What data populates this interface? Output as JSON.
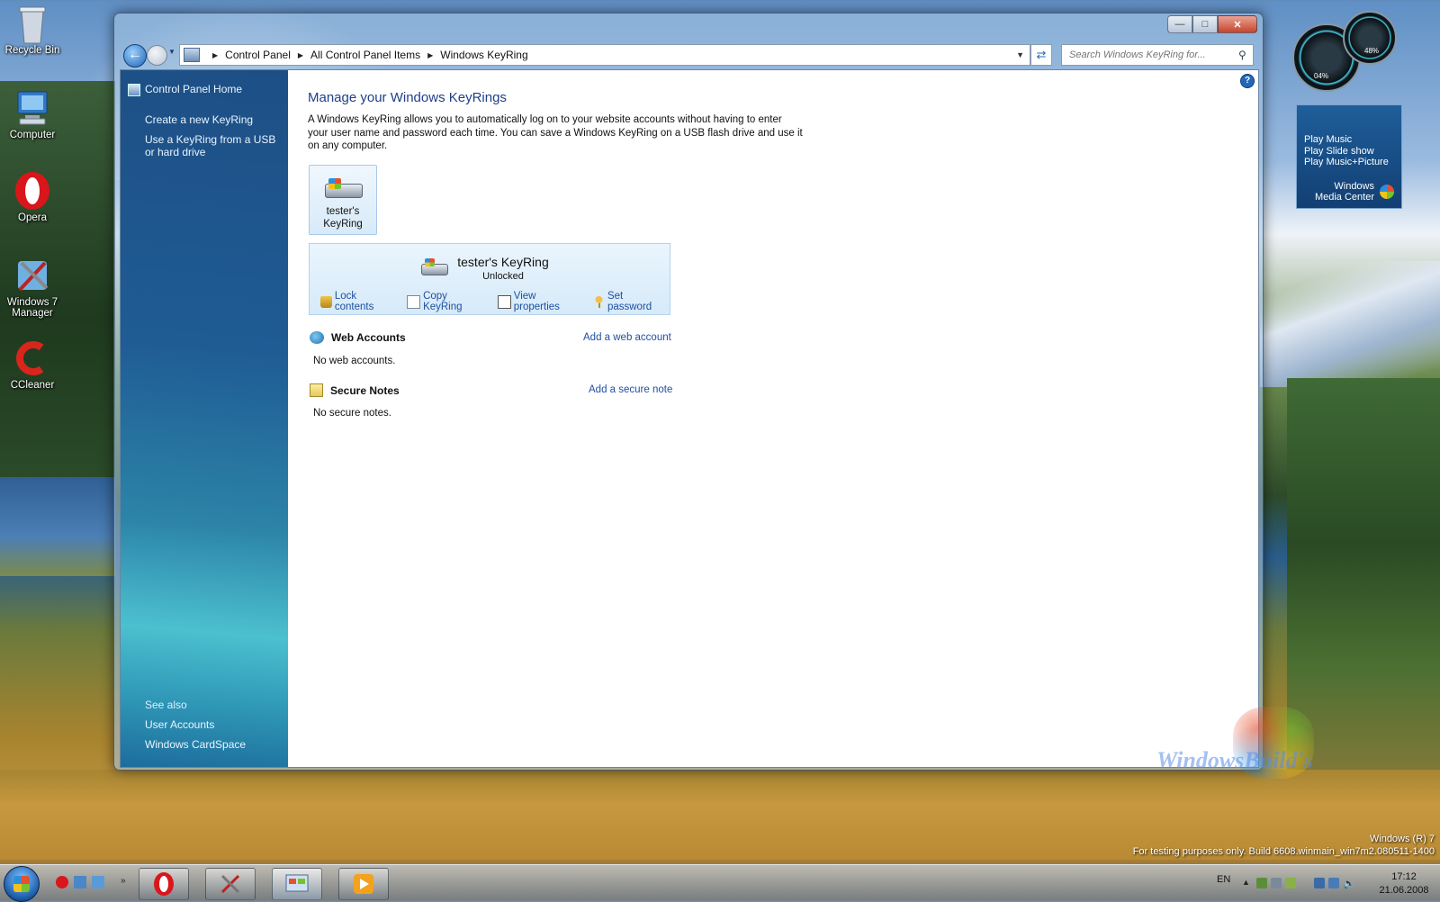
{
  "desktop": {
    "icons": [
      {
        "label": "Recycle Bin",
        "icon": "recycle-bin-icon"
      },
      {
        "label": "Computer",
        "icon": "computer-icon"
      },
      {
        "label": "Opera",
        "icon": "opera-icon"
      },
      {
        "label": "Windows 7 Manager",
        "icon": "windows7-manager-icon"
      },
      {
        "label": "CCleaner",
        "icon": "ccleaner-icon"
      }
    ],
    "build_line1": "Windows (R) 7",
    "build_line2": "For testing purposes only. Build 6608.winmain_win7m2.080511-1400"
  },
  "window": {
    "breadcrumb": [
      "Control Panel",
      "All Control Panel Items",
      "Windows KeyRing"
    ],
    "search_placeholder": "Search Windows KeyRing for...",
    "left_pane": {
      "home": "Control Panel Home",
      "links": [
        "Create a new KeyRing",
        "Use a KeyRing from a USB or hard drive"
      ],
      "see_also_title": "See also",
      "see_also": [
        "User Accounts",
        "Windows CardSpace"
      ]
    },
    "main": {
      "title": "Manage your Windows KeyRings",
      "description": "A Windows KeyRing allows you to automatically log on to your website accounts without having to enter your user name and password each time. You can save a Windows KeyRing on a USB flash drive and use it on any computer.",
      "tile_label": "tester's KeyRing",
      "panel_name": "tester's KeyRing",
      "panel_status": "Unlocked",
      "actions": [
        "Lock contents",
        "Copy KeyRing",
        "View properties",
        "Set password"
      ],
      "web_accounts": {
        "title": "Web Accounts",
        "add": "Add a web account",
        "empty": "No web accounts."
      },
      "secure_notes": {
        "title": "Secure Notes",
        "add": "Add a secure note",
        "empty": "No secure notes."
      }
    }
  },
  "gadgets": {
    "meter_value": "04%",
    "meter_value2": "48%",
    "media_center": {
      "items": [
        "Play Music",
        "Play Slide show",
        "Play Music+Picture"
      ],
      "brand_line1": "Windows",
      "brand_line2": "Media Center"
    }
  },
  "watermark": "WindowsBuild's",
  "taskbar": {
    "language": "EN",
    "time": "17:12",
    "date": "21.06.2008"
  }
}
